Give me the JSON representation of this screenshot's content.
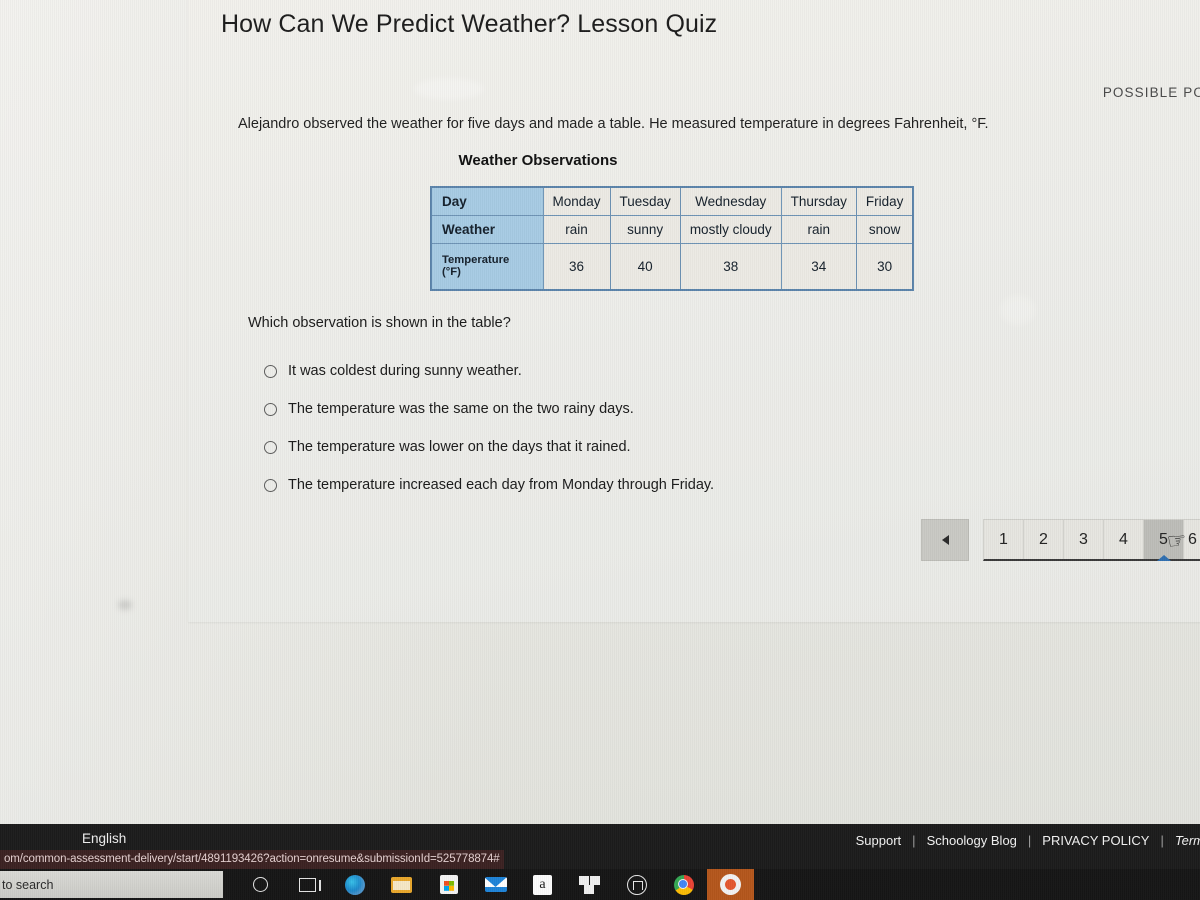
{
  "quiz": {
    "title": "How Can We Predict Weather? Lesson Quiz",
    "possible_points_label": "POSSIBLE POINT",
    "stem": "Alejandro observed the weather for five days and made a table. He measured temperature in degrees Fahrenheit, °F.",
    "table_caption": "Weather Observations",
    "question": "Which observation is shown in the table?"
  },
  "table": {
    "row_headers": [
      "Day",
      "Weather",
      "Temperature (°F)"
    ],
    "temperature_header_line1": "Temperature",
    "temperature_header_line2": "(°F)",
    "days": [
      "Monday",
      "Tuesday",
      "Wednesday",
      "Thursday",
      "Friday"
    ],
    "weather": [
      "rain",
      "sunny",
      "mostly cloudy",
      "rain",
      "snow"
    ],
    "temperatures": [
      "36",
      "40",
      "38",
      "34",
      "30"
    ],
    "header_color": "#a7cbe3",
    "border_color": "#5b84ab"
  },
  "options": [
    {
      "label": "It was coldest during sunny weather.",
      "selected": false
    },
    {
      "label": "The temperature was the same on the two rainy days.",
      "selected": false
    },
    {
      "label": "The temperature was lower on the days that it rained.",
      "selected": false
    },
    {
      "label": "The temperature increased each day from Monday through Friday.",
      "selected": false
    }
  ],
  "pager": {
    "prev_label": "◀",
    "pages": [
      "1",
      "2",
      "3",
      "4",
      "5",
      "6"
    ],
    "current_page": "5",
    "indicator_color": "#2f6fb0"
  },
  "footer": {
    "language": "English",
    "links": [
      "Support",
      "Schoology Blog",
      "PRIVACY POLICY",
      "Term"
    ],
    "separator": "|"
  },
  "status_bar": {
    "url": "om/common-assessment-delivery/start/4891193426?action=onresume&submissionId=525778874#"
  },
  "taskbar": {
    "search_placeholder": "to search",
    "icons": [
      "cortana-circle-icon",
      "task-view-icon",
      "edge-browser-icon",
      "file-explorer-icon",
      "microsoft-store-icon",
      "mail-icon",
      "amazon-icon",
      "dropbox-icon",
      "home-app-icon",
      "chrome-browser-icon",
      "orange-app-icon"
    ]
  }
}
